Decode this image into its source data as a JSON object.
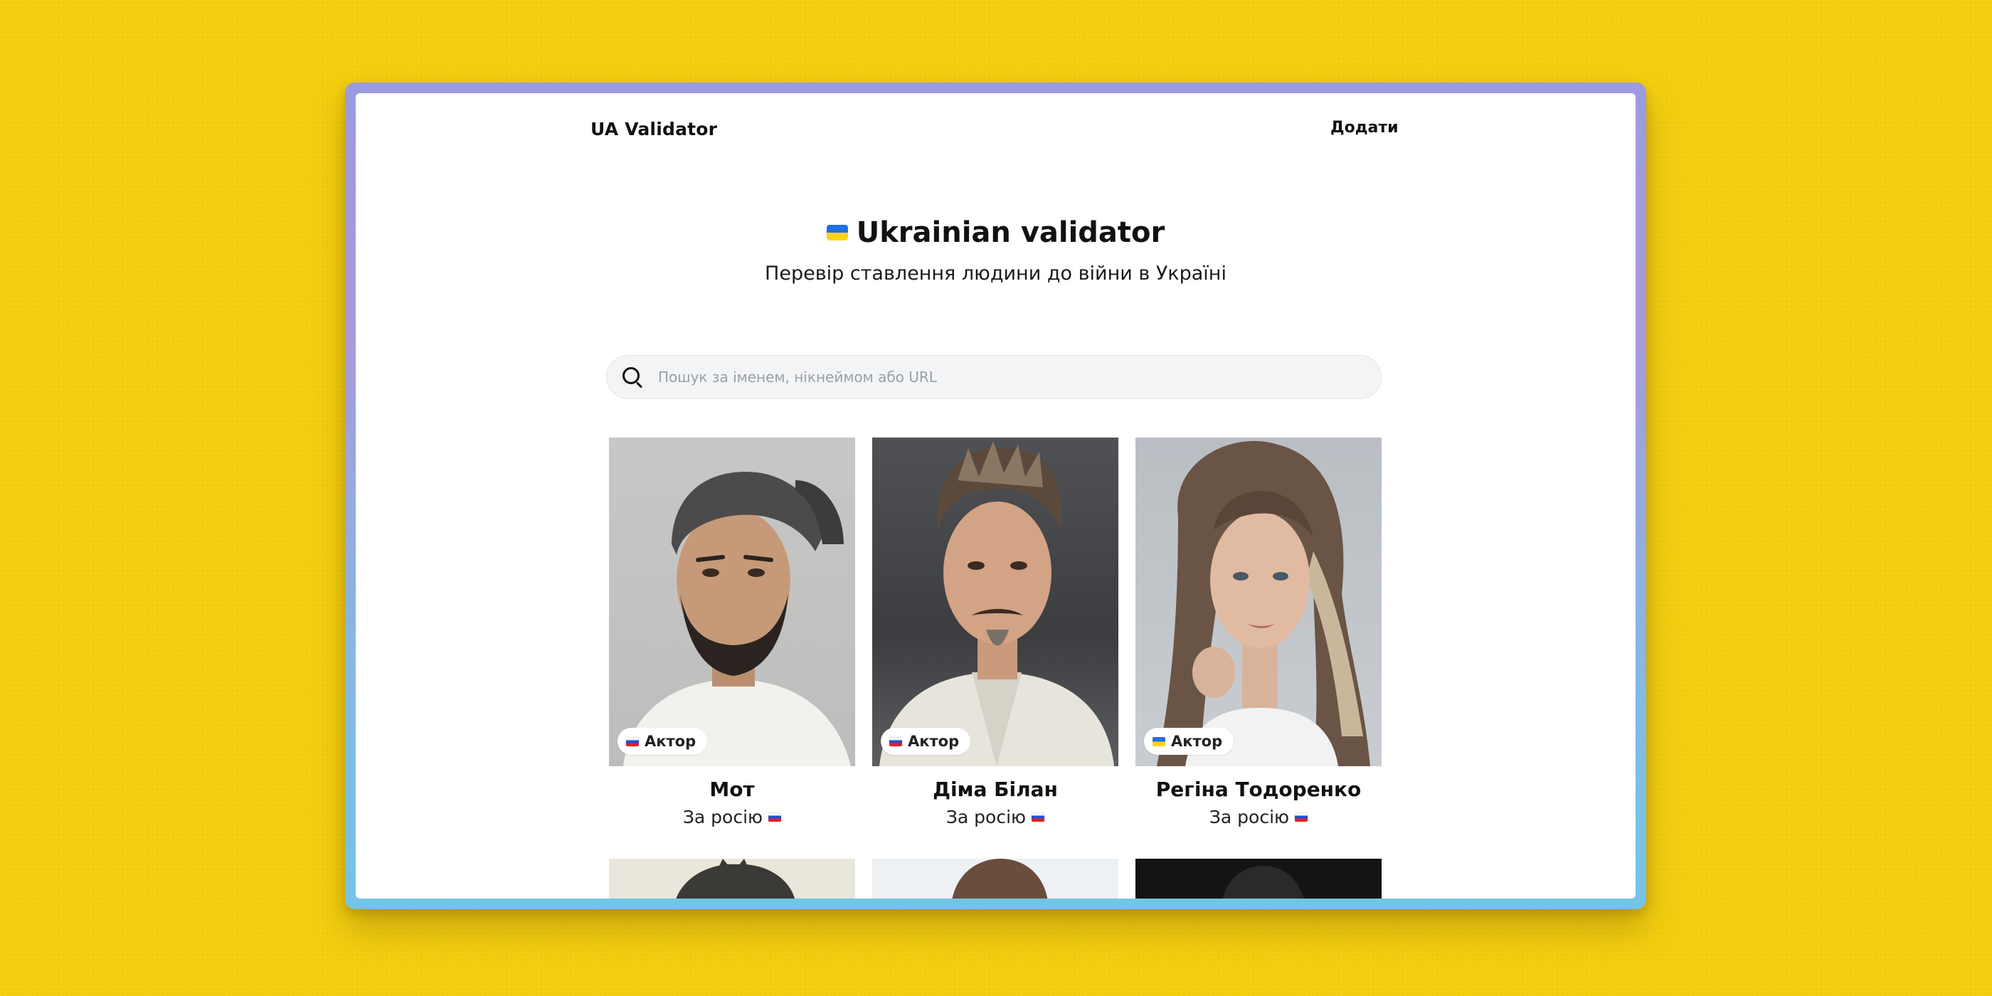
{
  "header": {
    "site_title": "UA Validator",
    "add_label": "Додати"
  },
  "hero": {
    "title": "Ukrainian validator",
    "flag_icon": "ukraine-flag-icon",
    "subtitle": "Перевір ставлення людини до війни в Україні"
  },
  "search": {
    "placeholder": "Пошук за іменем, нікнеймом або URL",
    "icon": "search-icon"
  },
  "cards": [
    {
      "name": "Мот",
      "badge": "Актор",
      "badge_flag": "russia-flag-icon",
      "status": "За росію",
      "status_flag": "russia-flag-icon"
    },
    {
      "name": "Діма Білан",
      "badge": "Актор",
      "badge_flag": "russia-flag-icon",
      "status": "За росію",
      "status_flag": "russia-flag-icon"
    },
    {
      "name": "Регіна Тодоренко",
      "badge": "Актор",
      "badge_flag": "ukraine-flag-icon",
      "status": "За росію",
      "status_flag": "russia-flag-icon"
    }
  ],
  "colors": {
    "background": "#f3cf0f",
    "frame_top": "#9c9be0",
    "frame_bottom": "#74c4e6",
    "search_bg": "#f3f4f6",
    "text": "#111111"
  }
}
